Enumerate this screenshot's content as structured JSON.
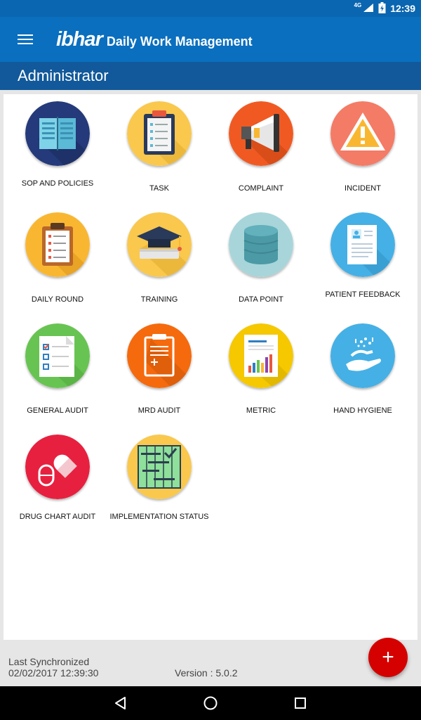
{
  "status_bar": {
    "network_label": "4G",
    "time": "12:39",
    "icons": [
      "signal-icon",
      "battery-icon"
    ]
  },
  "app_bar": {
    "menu_icon": "hamburger-menu-icon",
    "logo_text": "ibhar",
    "title": "Daily Work Management"
  },
  "sub_header": {
    "role": "Administrator"
  },
  "modules": [
    {
      "label": "SOP AND POLICIES",
      "icon": "book-icon",
      "color": "#253a7a"
    },
    {
      "label": "TASK",
      "icon": "clipboard-icon",
      "color": "#f9c84d"
    },
    {
      "label": "COMPLAINT",
      "icon": "megaphone-icon",
      "color": "#f05a22"
    },
    {
      "label": "INCIDENT",
      "icon": "warning-icon",
      "color": "#f47b66"
    },
    {
      "label": "DAILY ROUND",
      "icon": "checklist-clipboard-icon",
      "color": "#f9b731"
    },
    {
      "label": "TRAINING",
      "icon": "graduation-cap-icon",
      "color": "#f9c84d"
    },
    {
      "label": "DATA POINT",
      "icon": "database-icon",
      "color": "#a7d5da"
    },
    {
      "label": "PATIENT FEEDBACK",
      "icon": "patient-document-icon",
      "color": "#45b0e5"
    },
    {
      "label": "GENERAL AUDIT",
      "icon": "checkbox-list-icon",
      "color": "#68c452"
    },
    {
      "label": "MRD AUDIT",
      "icon": "medical-record-icon",
      "color": "#f56a0d"
    },
    {
      "label": "METRIC",
      "icon": "bar-report-icon",
      "color": "#f5c800"
    },
    {
      "label": "HAND HYGIENE",
      "icon": "hand-wash-icon",
      "color": "#45b0e5"
    },
    {
      "label": "DRUG CHART AUDIT",
      "icon": "pill-icon",
      "color": "#e8203f"
    },
    {
      "label": "IMPLEMENTATION STATUS",
      "icon": "status-grid-icon",
      "color": "#f9c84d"
    }
  ],
  "footer": {
    "sync_label": "Last Synchronized",
    "sync_time": "02/02/2017 12:39:30",
    "version": "Version : 5.0.2"
  },
  "fab": {
    "symbol": "+",
    "icon": "add-icon",
    "color": "#d50000"
  },
  "nav_bar": {
    "icons": [
      "back-icon",
      "home-icon",
      "recents-icon"
    ]
  }
}
